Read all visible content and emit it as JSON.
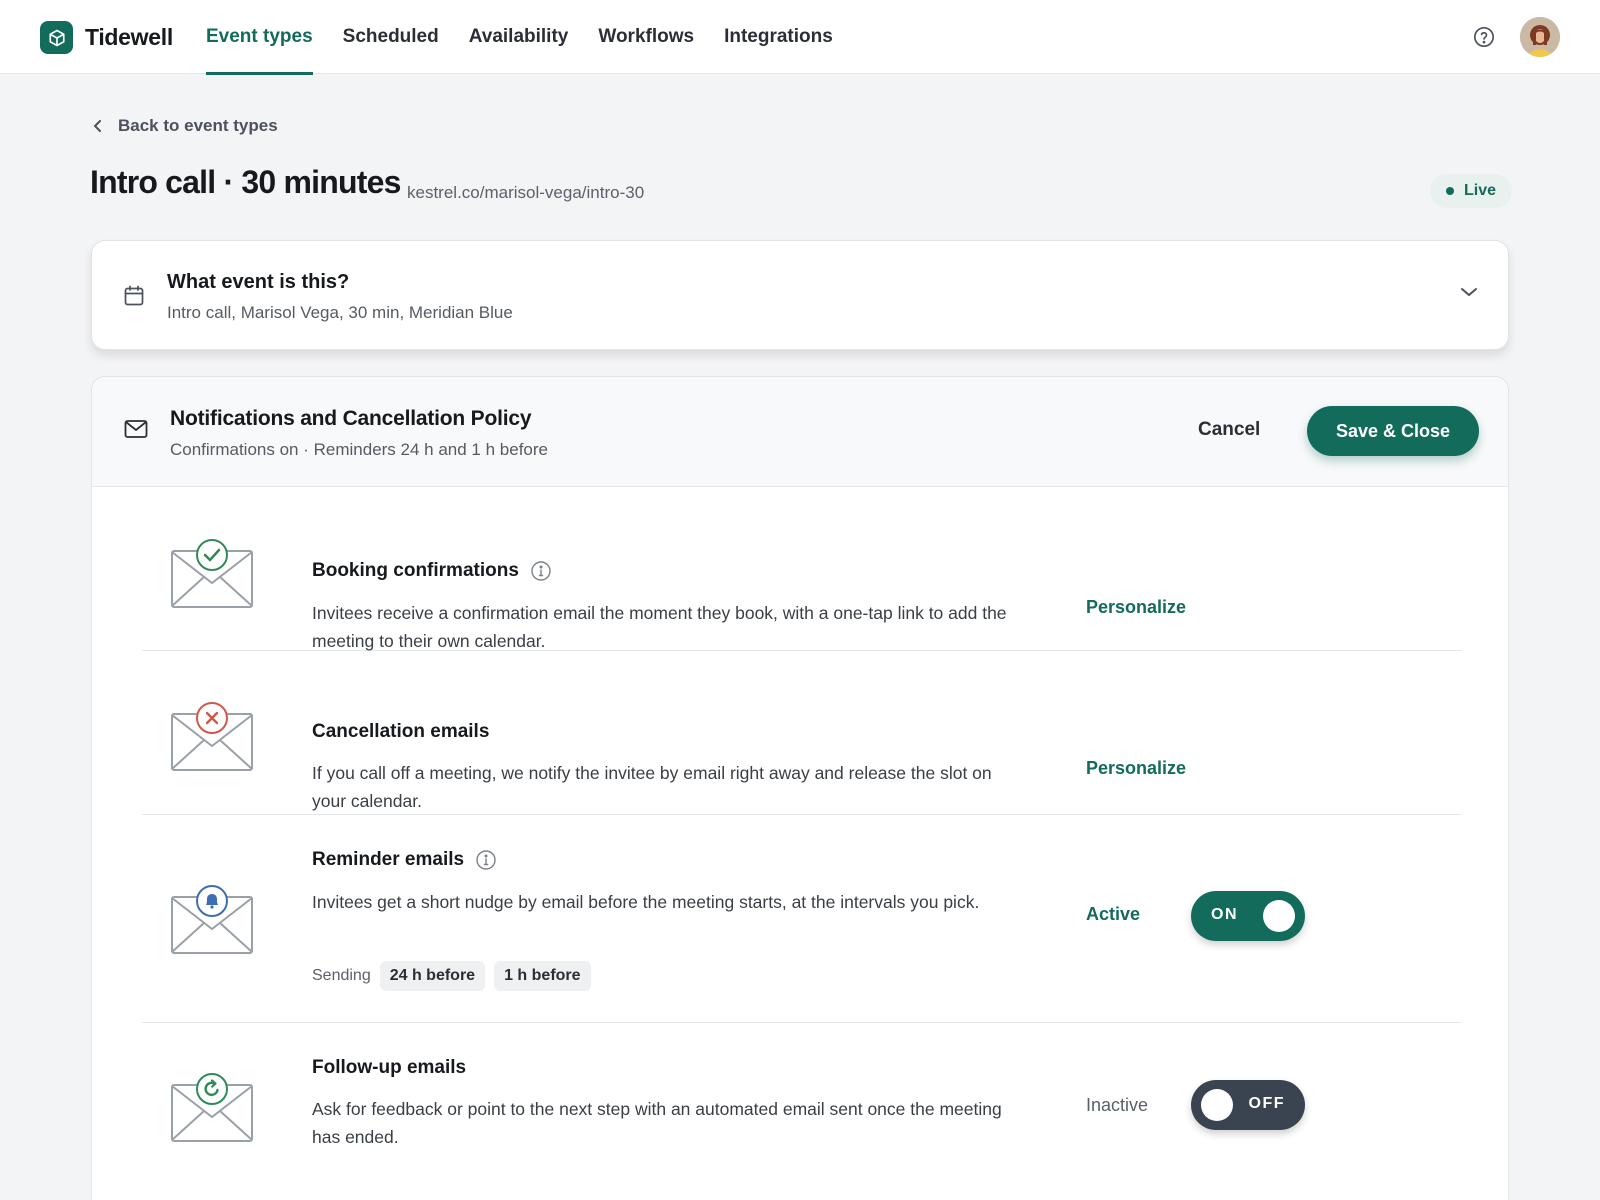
{
  "app": {
    "brand_name": "Tidewell",
    "brand_color": "#136b5c"
  },
  "nav": {
    "items": [
      {
        "label": "Event types",
        "active": true
      },
      {
        "label": "Scheduled",
        "active": false
      },
      {
        "label": "Availability",
        "active": false
      },
      {
        "label": "Workflows",
        "active": false
      },
      {
        "label": "Integrations",
        "active": false
      }
    ],
    "help_icon": "question-circle-icon",
    "avatar_icon": "user-avatar"
  },
  "page": {
    "back_label": "Back to event types",
    "title": "Intro call · 30 minutes",
    "url": "kestrel.co/marisol-vega/intro-30",
    "status": "Live"
  },
  "event_card": {
    "icon": "calendar-icon",
    "title": "What event is this?",
    "summary": "Intro call, Marisol Vega, 30 min, Meridian Blue"
  },
  "notifications_card": {
    "icon": "mail-icon",
    "title": "Notifications and Cancellation Policy",
    "summary": "Confirmations on · Reminders 24 h and 1 h before",
    "cancel_label": "Cancel",
    "save_label": "Save & Close",
    "rows": [
      {
        "title": "Booking confirmations",
        "has_info": true,
        "description": "Invitees receive a confirmation email the moment they book, with a one-tap link to add the meeting to their own calendar.",
        "action_label": "Personalize",
        "badge_icon": "check-icon",
        "badge_color": "#2e8b57"
      },
      {
        "title": "Cancellation emails",
        "has_info": false,
        "description": "If you call off a meeting, we notify the invitee by email right away and release the slot on your calendar.",
        "action_label": "Personalize",
        "badge_icon": "x-icon",
        "badge_color": "#d2574a"
      },
      {
        "title": "Reminder emails",
        "has_info": true,
        "description": "Invitees get a short nudge by email before the meeting starts, at the intervals you pick.",
        "state_label": "Active",
        "toggle_label": "ON",
        "toggle_on": true,
        "sending_label": "Sending",
        "chips": [
          "24 h before",
          "1 h before"
        ],
        "badge_icon": "bell-icon",
        "badge_color": "#3d6db3"
      },
      {
        "title": "Follow-up emails",
        "has_info": false,
        "description": "Ask for feedback or point to the next step with an automated email sent once the meeting has ended.",
        "state_label": "Inactive",
        "toggle_label": "OFF",
        "toggle_on": false,
        "badge_icon": "refresh-icon",
        "badge_color": "#2e8b57"
      }
    ]
  }
}
